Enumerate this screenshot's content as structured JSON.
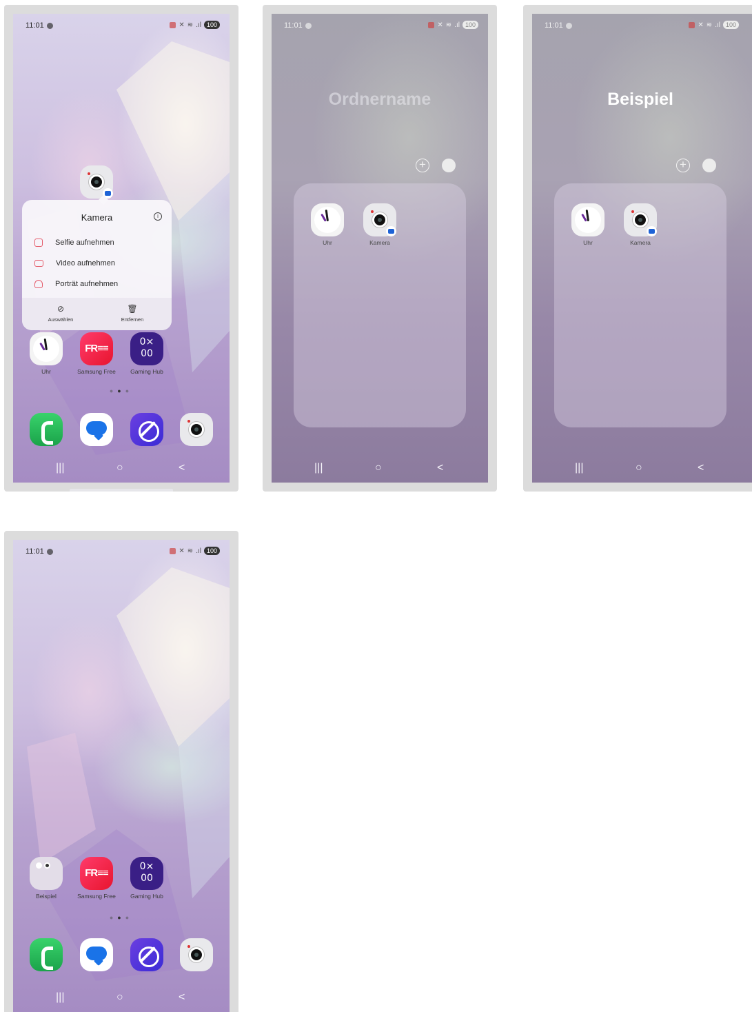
{
  "status_bar": {
    "time": "11:01",
    "battery": "100"
  },
  "home": {
    "folder_app": {
      "label": "Beispiel"
    },
    "apps": [
      {
        "label": "Uhr"
      },
      {
        "label": "Samsung Free"
      },
      {
        "label": "Gaming Hub"
      }
    ],
    "free_text": "FR≡≡",
    "gaming_text": "0×\n00"
  },
  "context_menu": {
    "title": "Kamera",
    "items": [
      "Selfie aufnehmen",
      "Video aufnehmen",
      "Porträt aufnehmen"
    ],
    "select_label": "Auswählen",
    "remove_label": "Entfernen"
  },
  "folder": {
    "name_placeholder": "Ordnername",
    "name_value": "Beispiel",
    "apps": [
      {
        "label": "Uhr"
      },
      {
        "label": "Kamera"
      }
    ]
  },
  "nav": {
    "recent": "|||",
    "home": "○",
    "back": "<"
  },
  "pager": "●●●",
  "colors": {
    "accent_blue": "#1e63d6",
    "wallpaper_purple": "#a58cc3"
  }
}
